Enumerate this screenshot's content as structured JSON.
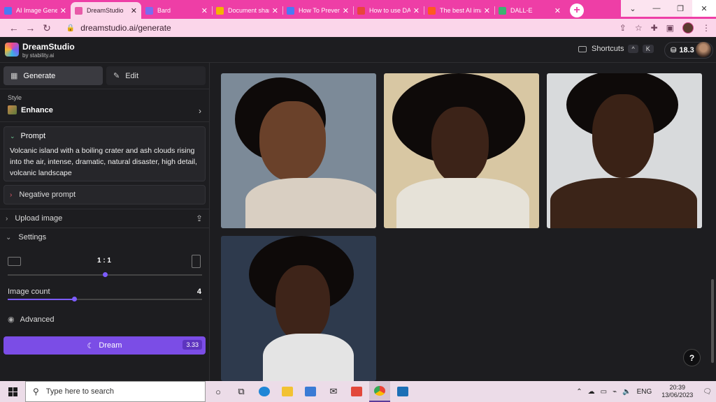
{
  "browser": {
    "tabs": [
      {
        "title": "AI Image Generator",
        "fav_color": "#4a7af5",
        "active": false
      },
      {
        "title": "DreamStudio",
        "fav_color": "#e85aa8",
        "active": true
      },
      {
        "title": "Bard",
        "fav_color": "#7a6cf0",
        "active": false
      },
      {
        "title": "Document sharing",
        "fav_color": "#f4b400",
        "active": false
      },
      {
        "title": "How To Prevent",
        "fav_color": "#4a7af5",
        "active": false
      },
      {
        "title": "How to use DALL-E",
        "fav_color": "#e8453c",
        "active": false
      },
      {
        "title": "The best AI image",
        "fav_color": "#ff5a1f",
        "active": false
      },
      {
        "title": "DALL-E",
        "fav_color": "#3cb371",
        "active": false
      }
    ],
    "url": "dreamstudio.ai/generate",
    "accent": "#ee3ea6"
  },
  "app": {
    "brand_name": "DreamStudio",
    "brand_sub": "by stability.ai",
    "shortcuts_label": "Shortcuts",
    "shortcut_keys": [
      "^",
      "K"
    ],
    "credits": "18.3"
  },
  "sidebar": {
    "modes": {
      "generate": "Generate",
      "edit": "Edit"
    },
    "style": {
      "label": "Style",
      "value": "Enhance"
    },
    "prompt": {
      "label": "Prompt",
      "text": "Volcanic island with a boiling crater and ash clouds rising into the air, intense, dramatic, natural disaster, high detail, volcanic landscape"
    },
    "negative_prompt_label": "Negative prompt",
    "upload_image_label": "Upload image",
    "settings_label": "Settings",
    "aspect_ratio": "1 : 1",
    "aspect_slider_fraction": 0.5,
    "image_count_label": "Image count",
    "image_count": "4",
    "image_count_fraction": 0.34,
    "advanced_label": "Advanced",
    "dream_label": "Dream",
    "dream_cost": "3.33",
    "dream_color": "#7b4de6"
  },
  "gallery": {
    "images": [
      {
        "desc": "smiling-child-knit-vest",
        "bg": "#7c8a98",
        "body": "#d9cfc2"
      },
      {
        "desc": "youth-white-shirt",
        "bg": "#d8c7a3",
        "body": "#e6e2d8"
      },
      {
        "desc": "woman-bare-shoulders",
        "bg": "#d8dadc",
        "body": "#3b2418"
      },
      {
        "desc": "youth-white-tank",
        "bg": "#2e3a4d",
        "body": "#e4e4e4"
      }
    ],
    "help_label": "?"
  },
  "taskbar": {
    "search_placeholder": "Type here to search",
    "language": "ENG",
    "time": "20:39",
    "date": "13/06/2023"
  }
}
